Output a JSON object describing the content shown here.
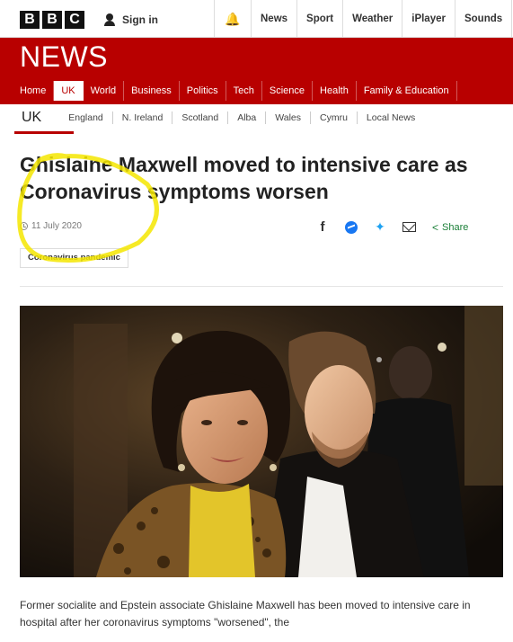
{
  "topbar": {
    "logo_letters": [
      "B",
      "B",
      "C"
    ],
    "signin_label": "Sign in",
    "nav": [
      "News",
      "Sport",
      "Weather",
      "iPlayer",
      "Sounds"
    ],
    "bell_icon": "bell-icon",
    "user_icon": "user-icon"
  },
  "news_band": {
    "title": "NEWS",
    "color": "#b80000",
    "sections": [
      "Home",
      "UK",
      "World",
      "Business",
      "Politics",
      "Tech",
      "Science",
      "Health",
      "Family & Education"
    ],
    "active_section": "UK"
  },
  "uk_nav": {
    "label": "UK",
    "items": [
      "England",
      "N. Ireland",
      "Scotland",
      "Alba",
      "Wales",
      "Cymru",
      "Local News"
    ]
  },
  "article": {
    "headline": "Ghislaine Maxwell moved to intensive care as Coronavirus symptoms worsen",
    "date": "11 July 2020",
    "share_label": "Share",
    "share_icons": [
      "facebook-icon",
      "messenger-icon",
      "twitter-icon",
      "email-icon",
      "share-icon"
    ],
    "tag": "Coronavirus pandemic",
    "body": "Former socialite and Epstein associate Ghislaine Maxwell has been moved to intensive care in hospital after her coronavirus symptoms \"worsened\", the"
  },
  "annotation_color": "#f5e600"
}
